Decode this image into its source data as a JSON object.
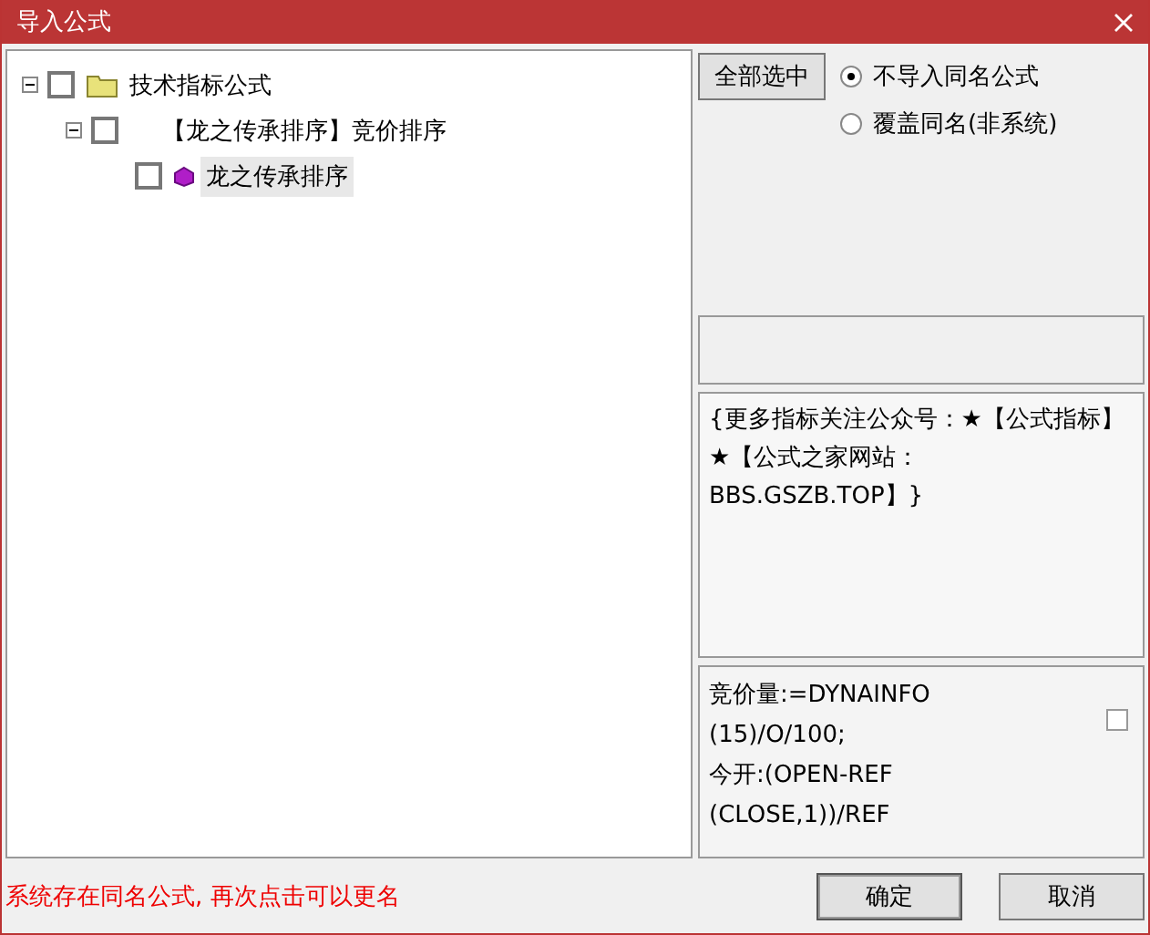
{
  "window": {
    "title": "导入公式"
  },
  "tree": [
    {
      "label": "技术指标公式",
      "kind": "folder",
      "expanded": true,
      "checked": false,
      "selected": false,
      "children": [
        {
          "label": "【龙之传承排序】竞价排序",
          "expanded": true,
          "checked": false,
          "selected": false,
          "children": [
            {
              "label": "龙之传承排序",
              "kind": "formula",
              "checked": false,
              "selected": true
            }
          ]
        }
      ]
    }
  ],
  "select_all_button": "全部选中",
  "radios": [
    {
      "label": "不导入同名公式",
      "selected": true
    },
    {
      "label": "覆盖同名(非系统)",
      "selected": false
    }
  ],
  "description": "{更多指标关注公众号：★【公式指标】★【公式之家网站：BBS.GSZB.TOP】}",
  "formula_text": [
    "竞价量:=DYNAINFO",
    "(15)/O/100;",
    "今开:(OPEN-REF",
    "(CLOSE,1))/REF"
  ],
  "formula_checkbox": {
    "checked": false
  },
  "status": "系统存在同名公式, 再次点击可以更名",
  "buttons": [
    "确定",
    "取消"
  ]
}
